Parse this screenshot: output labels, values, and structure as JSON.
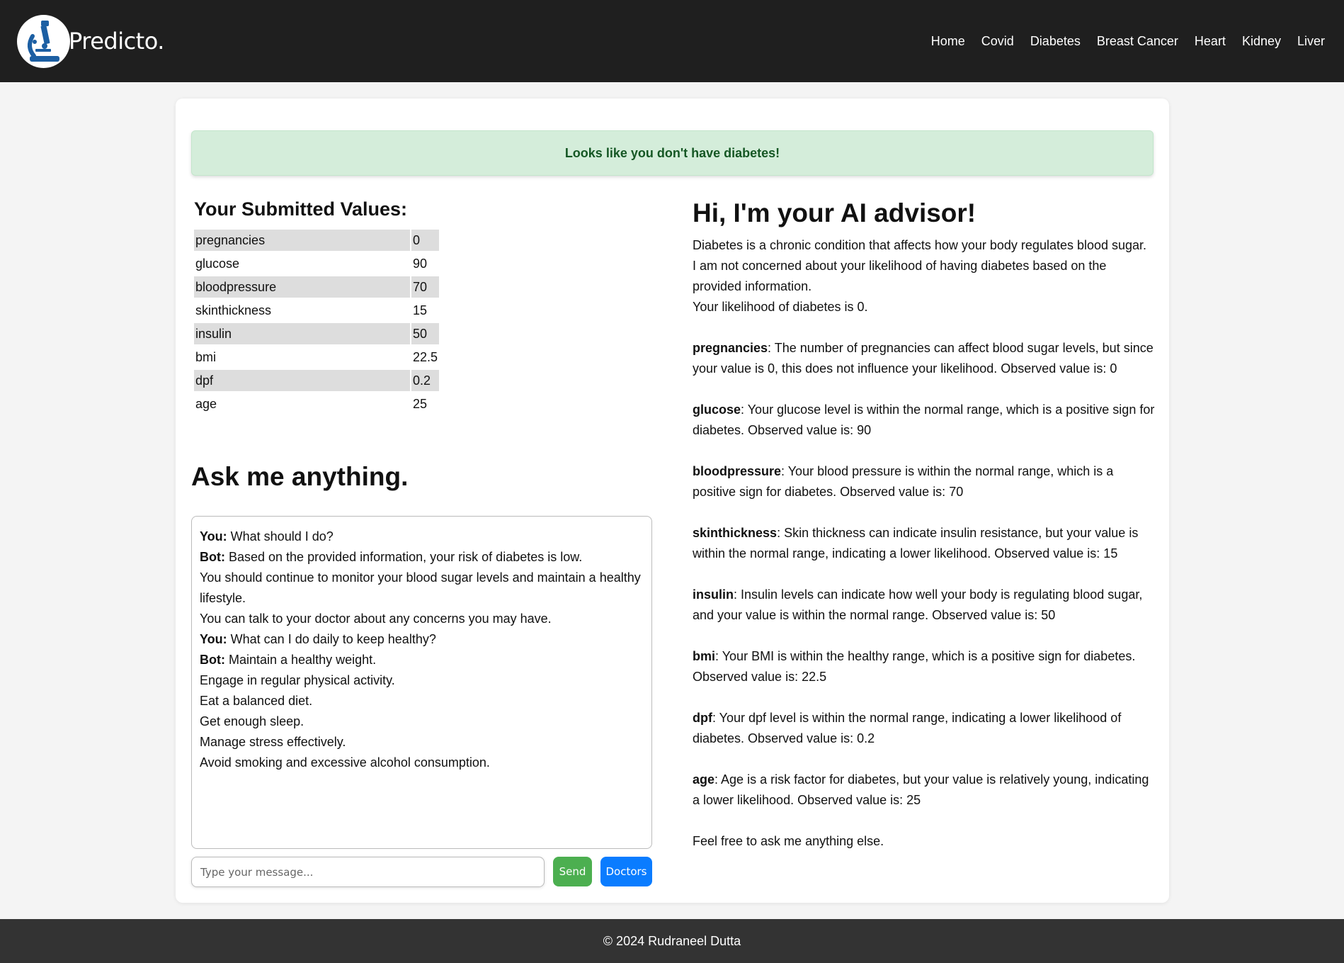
{
  "brand": {
    "name": "Predicto.",
    "logo_icon": "microscope-icon"
  },
  "nav": {
    "items": [
      "Home",
      "Covid",
      "Diabetes",
      "Breast Cancer",
      "Heart",
      "Kidney",
      "Liver"
    ]
  },
  "alert": {
    "message": "Looks like you don't have diabetes!"
  },
  "submitted": {
    "title": "Your Submitted Values:",
    "rows": [
      {
        "key": "pregnancies",
        "value": "0"
      },
      {
        "key": "glucose",
        "value": "90"
      },
      {
        "key": "bloodpressure",
        "value": "70"
      },
      {
        "key": "skinthickness",
        "value": "15"
      },
      {
        "key": "insulin",
        "value": "50"
      },
      {
        "key": "bmi",
        "value": "22.5"
      },
      {
        "key": "dpf",
        "value": "0.2"
      },
      {
        "key": "age",
        "value": "25"
      }
    ]
  },
  "chat": {
    "title": "Ask me anything.",
    "lines": [
      {
        "speaker": "You:",
        "text": " What should I do?"
      },
      {
        "speaker": "Bot:",
        "text": " Based on the provided information, your risk of diabetes is low."
      },
      {
        "speaker": "",
        "text": "You should continue to monitor your blood sugar levels and maintain a healthy lifestyle."
      },
      {
        "speaker": "",
        "text": "You can talk to your doctor about any concerns you may have."
      },
      {
        "speaker": "You:",
        "text": " What can I do daily to keep healthy?"
      },
      {
        "speaker": "Bot:",
        "text": " Maintain a healthy weight."
      },
      {
        "speaker": "",
        "text": "Engage in regular physical activity."
      },
      {
        "speaker": "",
        "text": "Eat a balanced diet."
      },
      {
        "speaker": "",
        "text": "Get enough sleep."
      },
      {
        "speaker": "",
        "text": "Manage stress effectively."
      },
      {
        "speaker": "",
        "text": "Avoid smoking and excessive alcohol consumption."
      }
    ],
    "input_placeholder": "Type your message...",
    "input_value": "",
    "send_label": "Send",
    "doctors_label": "Doctors"
  },
  "advisor": {
    "title": "Hi, I'm your AI advisor!",
    "intro": [
      "Diabetes is a chronic condition that affects how your body regulates blood sugar.",
      "I am not concerned about your likelihood of having diabetes based on the provided information.",
      "Your likelihood of diabetes is 0."
    ],
    "features": [
      {
        "name": "pregnancies",
        "text": ": The number of pregnancies can affect blood sugar levels, but since your value is 0, this does not influence your likelihood. Observed value is: 0"
      },
      {
        "name": "glucose",
        "text": ": Your glucose level is within the normal range, which is a positive sign for diabetes. Observed value is: 90"
      },
      {
        "name": "bloodpressure",
        "text": ": Your blood pressure is within the normal range, which is a positive sign for diabetes. Observed value is: 70"
      },
      {
        "name": "skinthickness",
        "text": ": Skin thickness can indicate insulin resistance, but your value is within the normal range, indicating a lower likelihood. Observed value is: 15"
      },
      {
        "name": "insulin",
        "text": ": Insulin levels can indicate how well your body is regulating blood sugar, and your value is within the normal range. Observed value is: 50"
      },
      {
        "name": "bmi",
        "text": ": Your BMI is within the healthy range, which is a positive sign for diabetes. Observed value is: 22.5"
      },
      {
        "name": "dpf",
        "text": ": Your dpf level is within the normal range, indicating a lower likelihood of diabetes. Observed value is: 0.2"
      },
      {
        "name": "age",
        "text": ": Age is a risk factor for diabetes, but your value is relatively young, indicating a lower likelihood. Observed value is: 25"
      }
    ],
    "closing": "Feel free to ask me anything else."
  },
  "footer": {
    "text": "© 2024 Rudraneel Dutta"
  },
  "colors": {
    "navbar": "#1f1f1f",
    "alert_bg": "#d4edda",
    "alert_text": "#155724",
    "send_button": "#4caf50",
    "doctors_button": "#0a7cff",
    "logo_blue": "#1c5fa3",
    "footer": "#333333"
  }
}
